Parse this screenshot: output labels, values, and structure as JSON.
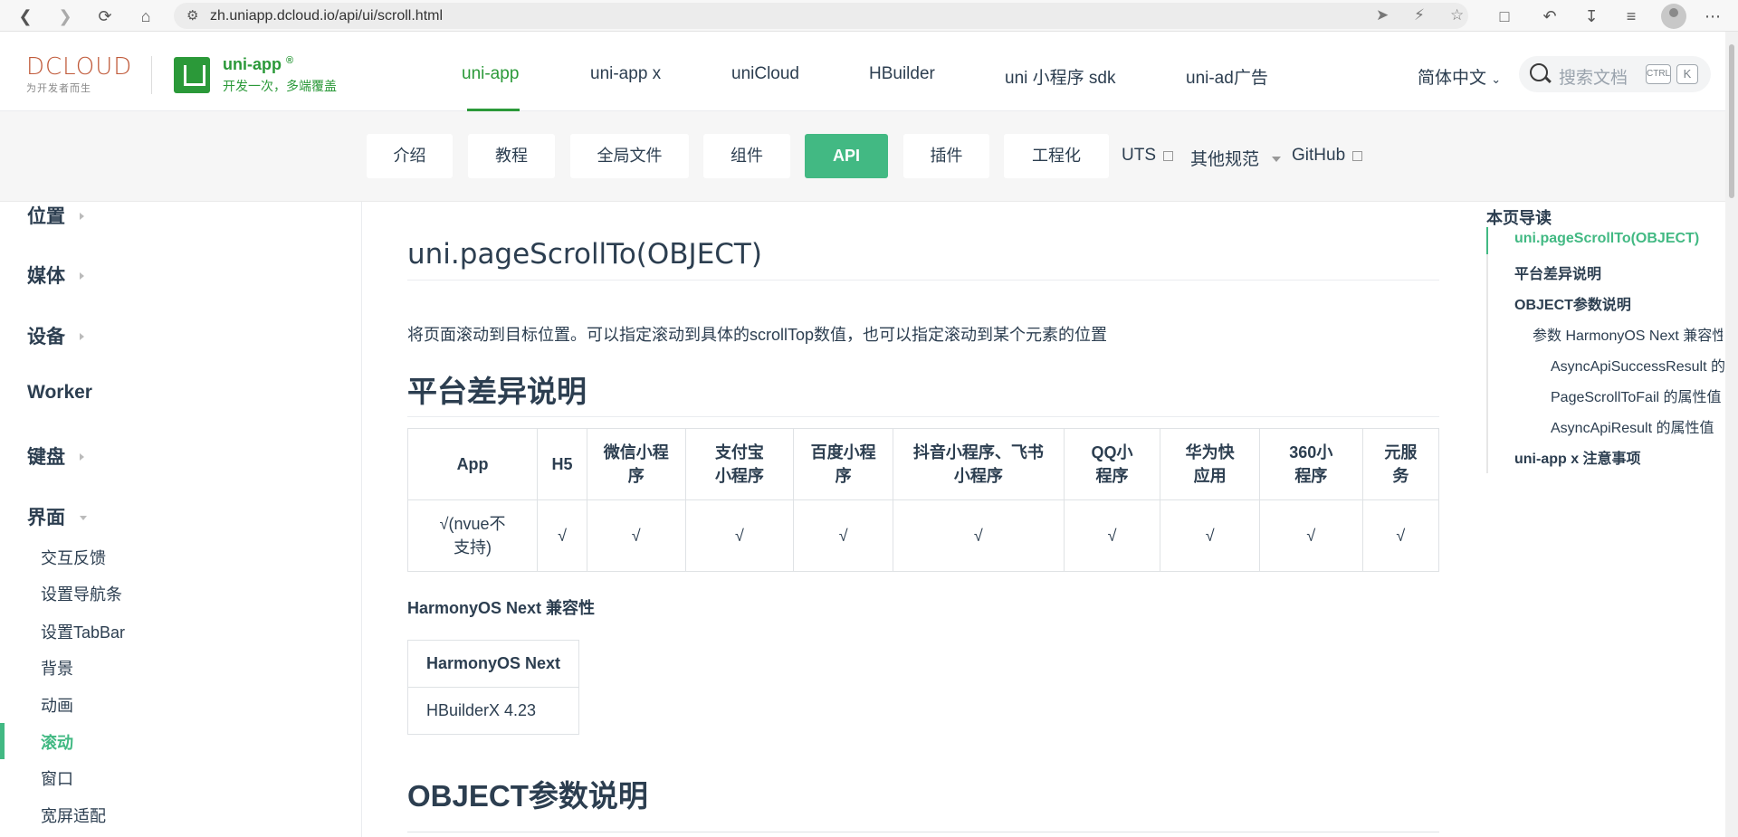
{
  "browser": {
    "url": "zh.uniapp.dcloud.io/api/ui/scroll.html"
  },
  "header": {
    "dcloud_logo": "DCLOUD",
    "dcloud_tag": "为开发者而生",
    "uni_name": "uni-app",
    "uni_slogan": "开发一次，多端覆盖",
    "nav": [
      "uni-app",
      "uni-app x",
      "uniCloud",
      "HBuilder",
      "uni 小程序 sdk",
      "uni-ad广告"
    ],
    "language": "简体中文",
    "search_placeholder": "搜索文档",
    "kbd_ctrl": "CTRL",
    "kbd_k": "K"
  },
  "subnav": {
    "buttons": [
      "介绍",
      "教程",
      "全局文件",
      "组件",
      "API",
      "插件",
      "工程化"
    ],
    "uts": "UTS",
    "other": "其他规范",
    "github": "GitHub"
  },
  "sidebar": {
    "groups": [
      "位置",
      "媒体",
      "设备",
      "Worker",
      "键盘",
      "界面"
    ],
    "items": [
      "交互反馈",
      "设置导航条",
      "设置TabBar",
      "背景",
      "动画",
      "滚动",
      "窗口",
      "宽屏适配"
    ]
  },
  "main": {
    "title": "uni.pageScrollTo(OBJECT)",
    "description": "将页面滚动到目标位置。可以指定滚动到具体的scrollTop数值，也可以指定滚动到某个元素的位置",
    "h2_platform": "平台差异说明",
    "platform_headers": [
      "App",
      "H5",
      "微信小程序",
      "支付宝小程序",
      "百度小程序",
      "抖音小程序、飞书小程序",
      "QQ小程序",
      "华为快应用",
      "360小程序",
      "元服务"
    ],
    "platform_values": [
      "√(nvue不支持)",
      "√",
      "√",
      "√",
      "√",
      "√",
      "√",
      "√",
      "√",
      "√"
    ],
    "harmony_title": "HarmonyOS Next 兼容性",
    "harmony_header": "HarmonyOS Next",
    "harmony_value": "HBuilderX 4.23",
    "h2_object": "OBJECT参数说明"
  },
  "toc": {
    "title": "本页导读",
    "items": [
      "uni.pageScrollTo(OBJECT)",
      "平台差异说明",
      "OBJECT参数说明",
      "参数 HarmonyOS Next 兼容性",
      "AsyncApiSuccessResult 的属性值",
      "PageScrollToFail 的属性值",
      "AsyncApiResult 的属性值",
      "uni-app x 注意事项"
    ]
  }
}
